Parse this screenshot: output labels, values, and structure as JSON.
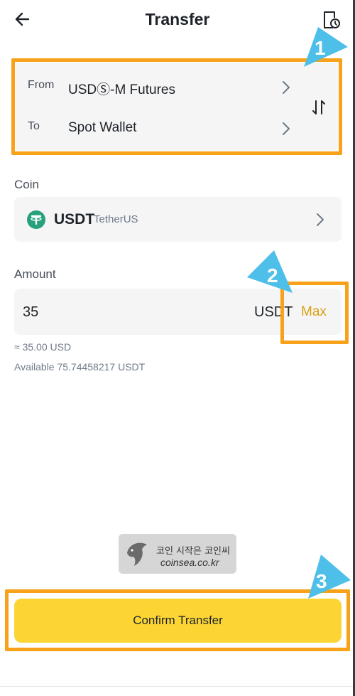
{
  "header": {
    "title": "Transfer",
    "back_icon": "arrow-left-icon",
    "history_icon": "history-icon"
  },
  "transfer": {
    "from_label": "From",
    "from_value": "USDⓈ-M Futures",
    "to_label": "To",
    "to_value": "Spot Wallet",
    "swap_icon": "swap-vertical-icon"
  },
  "coin": {
    "label": "Coin",
    "symbol": "USDT",
    "name": "TetherUS",
    "icon_color": "#26a17b"
  },
  "amount": {
    "label": "Amount",
    "value": "35",
    "unit": "USDT",
    "max_label": "Max",
    "approx": "≈ 35.00 USD",
    "available": "Available 75.74458217 USDT"
  },
  "watermark": {
    "line1": "코인 시작은 코인씨",
    "line2": "coinsea.co.kr"
  },
  "annotations": {
    "step1": "1",
    "step2": "2",
    "step3": "3",
    "highlight_color": "#f7a21a",
    "arrow_color": "#4dbfe8"
  },
  "confirm": {
    "label": "Confirm Transfer",
    "color": "#fcd535"
  },
  "colors": {
    "accent": "#fcd535",
    "max_text": "#d89f11"
  }
}
